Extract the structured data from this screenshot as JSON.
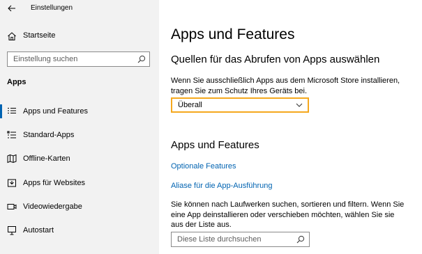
{
  "window": {
    "title": "Einstellungen"
  },
  "sidebar": {
    "home_label": "Startseite",
    "search": {
      "placeholder": "Einstellung suchen",
      "value": ""
    },
    "section_heading": "Apps",
    "items": [
      {
        "label": "Apps und Features",
        "icon": "apps-features-icon",
        "active": true
      },
      {
        "label": "Standard-Apps",
        "icon": "default-apps-icon",
        "active": false
      },
      {
        "label": "Offline-Karten",
        "icon": "offline-maps-icon",
        "active": false
      },
      {
        "label": "Apps für Websites",
        "icon": "apps-websites-icon",
        "active": false
      },
      {
        "label": "Videowiedergabe",
        "icon": "video-playback-icon",
        "active": false
      },
      {
        "label": "Autostart",
        "icon": "startup-icon",
        "active": false
      }
    ]
  },
  "main": {
    "title": "Apps und Features",
    "source_heading": "Quellen für das Abrufen von Apps auswählen",
    "source_description": "Wenn Sie ausschließlich Apps aus dem Microsoft Store installieren, tragen Sie zum Schutz Ihres Geräts bei.",
    "source_dropdown_value": "Überall",
    "apps_heading": "Apps und Features",
    "optional_features_link": "Optionale Features",
    "app_alias_link": "Aliase für die App-Ausführung",
    "list_description": "Sie können nach Laufwerken suchen, sortieren und filtern. Wenn Sie eine App deinstallieren oder verschieben möchten, wählen Sie sie aus der Liste aus.",
    "list_search": {
      "placeholder": "Diese Liste durchsuchen",
      "value": ""
    }
  },
  "colors": {
    "accent": "#0063b1",
    "focus_border": "#f5a81d",
    "sidebar_bg": "#f2f2f2"
  }
}
